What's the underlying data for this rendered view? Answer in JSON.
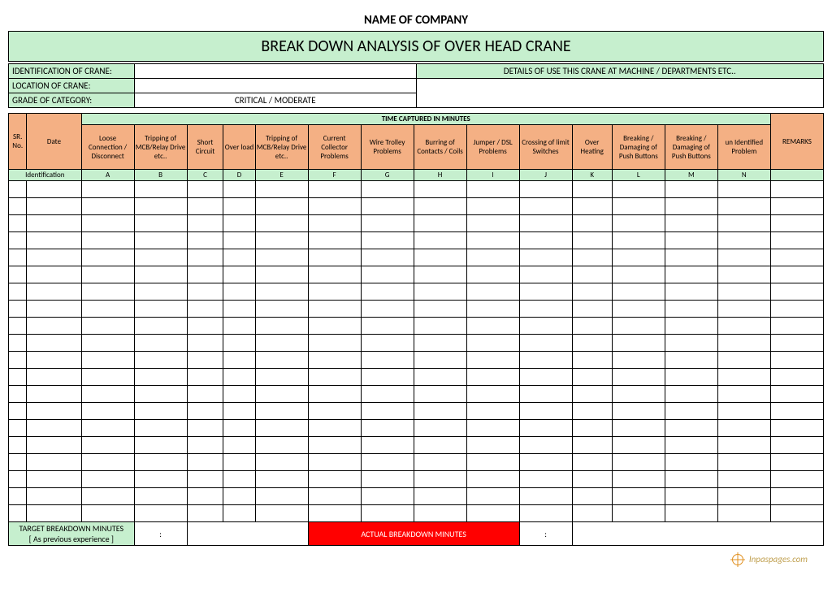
{
  "company": "NAME OF COMPANY",
  "title": "BREAK DOWN ANALYSIS OF OVER HEAD CRANE",
  "info": {
    "identification_label": "IDENTIFICATION OF CRANE:",
    "identification_value": "",
    "location_label": "LOCATION OF CRANE:",
    "location_value": "",
    "grade_label": "GRADE OF CATEGORY:",
    "grade_value": "CRITICAL / MODERATE",
    "details_header": "DETAILS OF USE THIS CRANE AT  MACHINE / DEPARTMENTS ETC..",
    "details_value": ""
  },
  "time_caption": "TIME CAPTURED IN MINUTES",
  "headers": {
    "sr": "SR. No.",
    "date": "Date",
    "remarks": "REMARKS",
    "identification": "Identification"
  },
  "columns": [
    {
      "label": "Loose Connection / Disconnect",
      "id": "A"
    },
    {
      "label": "Tripping of MCB/Relay Drive etc..",
      "id": "B"
    },
    {
      "label": "Short Circuit",
      "id": "C"
    },
    {
      "label": "Over load",
      "id": "D"
    },
    {
      "label": "Tripping of MCB/Relay Drive etc..",
      "id": "E"
    },
    {
      "label": "Current Collector Problems",
      "id": "F"
    },
    {
      "label": "Wire Trolley Problems",
      "id": "G"
    },
    {
      "label": "Burring of Contacts / Coils",
      "id": "H"
    },
    {
      "label": "Jumper / DSL Problems",
      "id": "I"
    },
    {
      "label": "Crossing of limit Switches",
      "id": "J"
    },
    {
      "label": "Over Heating",
      "id": "K"
    },
    {
      "label": "Breaking / Damaging of Push Buttons",
      "id": "L"
    },
    {
      "label": "Breaking / Damaging of Push Buttons",
      "id": "M"
    },
    {
      "label": "un Identified Problem",
      "id": "N"
    }
  ],
  "data_rows": 20,
  "footer": {
    "target_line1": "TARGET BREAKDOWN MINUTES",
    "target_line2": "[ As previous experience ]",
    "target_colon": ":",
    "actual_label": "ACTUAL BREAKDOWN MINUTES",
    "actual_colon": ":"
  },
  "watermark": "Inpaspages.com"
}
